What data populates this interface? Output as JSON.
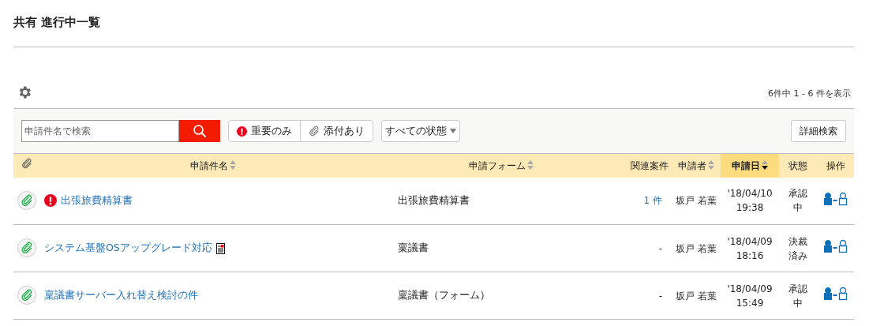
{
  "page_title": "共有 進行中一覧",
  "count_text": "6件中 1 - 6 件を表示",
  "search": {
    "placeholder": "申請件名で検索"
  },
  "filters": [
    {
      "label": "重要のみ",
      "kind": "important"
    },
    {
      "label": "添付あり",
      "kind": "attachment"
    }
  ],
  "status_select": {
    "value": "すべての状態"
  },
  "advanced_search": "詳細検索",
  "table": {
    "columns": [
      {
        "kind": "attachment",
        "sortable": false,
        "selected": false
      },
      {
        "label": "申請件名",
        "sortable": true,
        "selected": false
      },
      {
        "label": "申請フォーム",
        "sortable": true,
        "selected": false
      },
      {
        "label": "関連案件",
        "sortable": false,
        "selected": false
      },
      {
        "label": "申請者",
        "sortable": true,
        "selected": false
      },
      {
        "label": "申請日",
        "sortable": true,
        "selected": true
      },
      {
        "label": "状態",
        "sortable": false,
        "selected": false
      },
      {
        "label": "操作",
        "sortable": false,
        "selected": false
      }
    ],
    "rows": [
      {
        "attachment": true,
        "important": true,
        "document": false,
        "name": "出張旅費精算書",
        "form": "出張旅費精算書",
        "related": "1 件",
        "related_linked": true,
        "applicant": "坂戸 若葉",
        "date": "'18/04/10",
        "time": "19:38",
        "status": [
          "承認",
          "中"
        ]
      },
      {
        "attachment": true,
        "important": false,
        "document": true,
        "name": "システム基盤OSアップグレード対応",
        "form": "稟議書",
        "related": "-",
        "related_linked": false,
        "applicant": "坂戸 若葉",
        "date": "'18/04/09",
        "time": "18:16",
        "status": [
          "決裁",
          "済み"
        ]
      },
      {
        "attachment": true,
        "important": false,
        "document": false,
        "name": "稟議書サーバー入れ替え検討の件",
        "form": "稟議書（フォーム）",
        "related": "-",
        "related_linked": false,
        "applicant": "坂戸 若葉",
        "date": "'18/04/09",
        "time": "15:49",
        "status": [
          "承認",
          "中"
        ]
      }
    ]
  }
}
